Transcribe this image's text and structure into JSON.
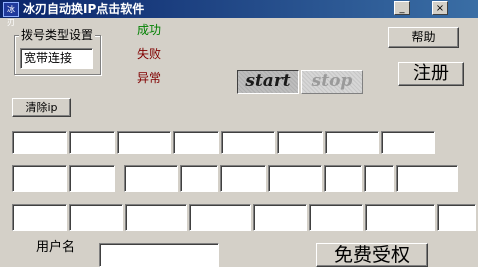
{
  "window": {
    "title": "冰刃自动换IP点击软件",
    "icon_name": "app-icon",
    "icon_text": "冰刃",
    "minimize_label": "_",
    "close_label": "×"
  },
  "dial_group": {
    "label": "拨号类型设置",
    "value": "宽带连接"
  },
  "status": {
    "success_label": "成功",
    "success_color": "#008000",
    "fail_label": "失败",
    "fail_color": "#800000",
    "error_label": "异常",
    "error_color": "#800000"
  },
  "buttons": {
    "help": "帮助",
    "register": "注册",
    "start": "start",
    "stop": "stop",
    "clear_ip": "清除ip",
    "free_auth": "免费受权"
  },
  "register": {
    "username_label": "用户名",
    "username_value": ""
  },
  "ip_rows": [
    [
      "",
      "",
      "",
      "",
      "",
      "",
      "",
      ""
    ],
    [
      "",
      "",
      "",
      "",
      "",
      "",
      "",
      "",
      ""
    ],
    [
      "",
      "",
      "",
      "",
      "",
      "",
      "",
      ""
    ]
  ]
}
